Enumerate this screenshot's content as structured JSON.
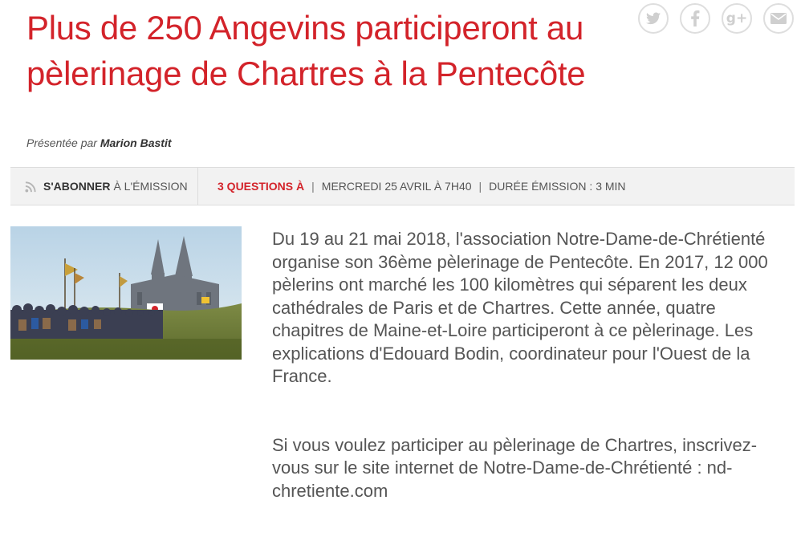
{
  "article": {
    "title": "Plus de 250 Angevins participeront au pèlerinage de Chartres à la Pentecôte",
    "presented_prefix": "Présentée par",
    "presenter": "Marion Bastit"
  },
  "share": [
    {
      "icon": "twitter-icon",
      "glyph": "twitter"
    },
    {
      "icon": "facebook-icon",
      "glyph": "f"
    },
    {
      "icon": "google-plus-icon",
      "glyph": "g+"
    },
    {
      "icon": "email-icon",
      "glyph": "mail"
    }
  ],
  "infobar": {
    "subscribe_strong": "S'ABONNER",
    "subscribe_rest": "À L'ÉMISSION",
    "show_name": "3 QUESTIONS À",
    "separator": "|",
    "date": "MERCREDI 25 AVRIL À 7H40",
    "duration": "DURÉE ÉMISSION : 3 MIN"
  },
  "body": {
    "paragraph1": "Du 19 au 21 mai 2018, l'association Notre-Dame-de-Chrétienté organise son 36ème pèlerinage de Pentecôte. En 2017, 12 000 pèlerins ont marché les 100 kilomètres qui séparent les deux cathédrales de Paris et de Chartres. Cette année, quatre chapitres de Maine-et-Loire participeront à ce pèlerinage. Les explications d'Edouard Bodin, coordinateur pour l'Ouest de la France.",
    "paragraph2": "Si vous voulez participer au pèlerinage de Chartres, inscrivez-vous sur le site internet de Notre-Dame-de-Chrétienté : nd-chretiente.com"
  },
  "colors": {
    "accent": "#d3232a",
    "bar_background": "#f2f2f2",
    "icon_grey": "#cfcfcf"
  }
}
